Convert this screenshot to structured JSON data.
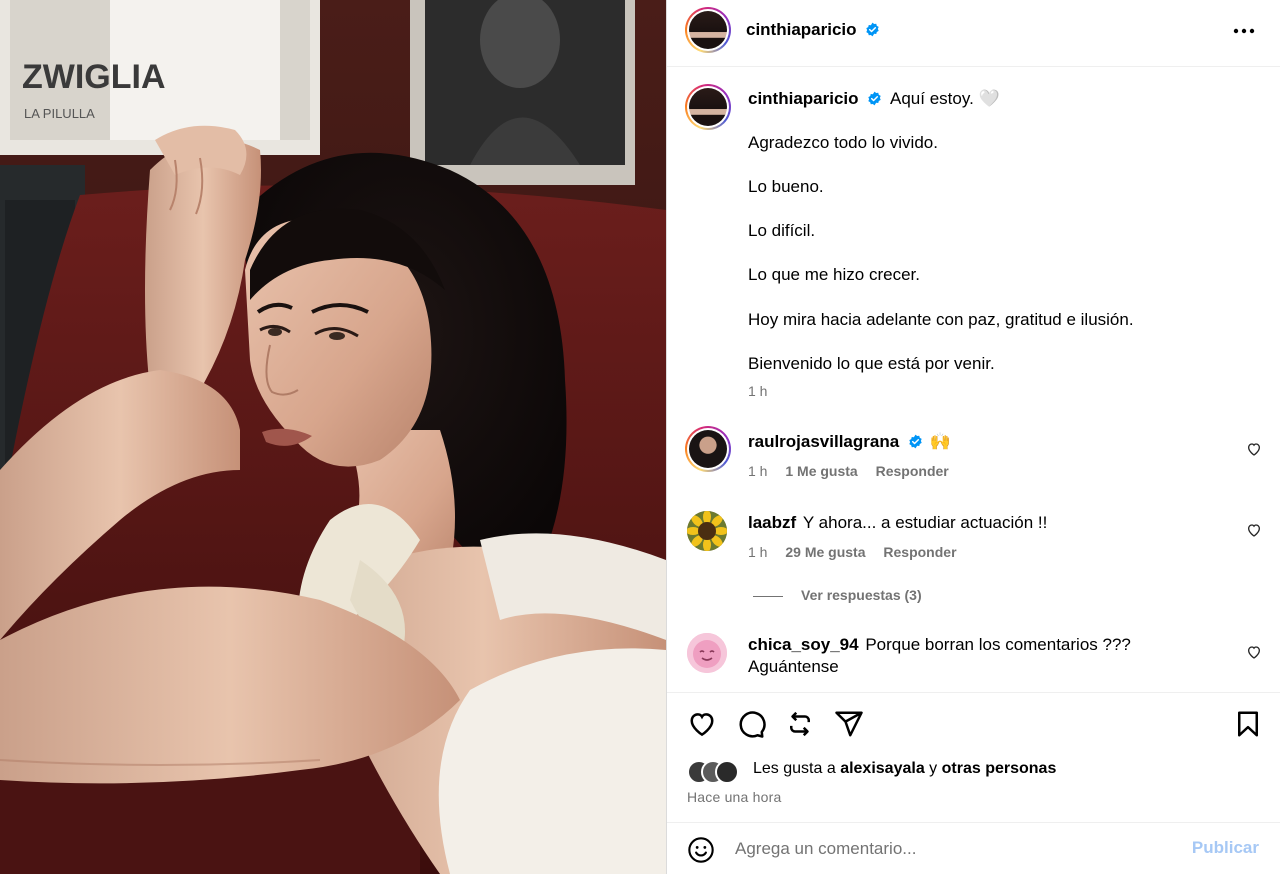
{
  "post": {
    "author": "cinthiaparicio",
    "author_verified": true,
    "more_icon": "more-horizontal-icon",
    "photo_wall_text_1": "ZWIGLIA",
    "photo_wall_text_2": "LA PILULLA"
  },
  "caption": {
    "author": "cinthiaparicio",
    "first_line": "Aquí estoy. 🤍",
    "lines": [
      "Agradezco todo lo vivido.",
      "Lo bueno.",
      "Lo difícil.",
      "Lo que me hizo crecer.",
      "Hoy mira hacia adelante con paz, gratitud e ilusión.",
      "Bienvenido lo que está por venir."
    ],
    "time": "1 h"
  },
  "comments": [
    {
      "user": "raulrojasvillagrana",
      "verified": true,
      "text": "🙌",
      "time": "1 h",
      "likes": "1 Me gusta",
      "reply": "Responder"
    },
    {
      "user": "laabzf",
      "verified": false,
      "text": "Y ahora... a estudiar actuación !!",
      "time": "1 h",
      "likes": "29 Me gusta",
      "reply": "Responder",
      "view_replies": "Ver respuestas (3)"
    },
    {
      "user": "chica_soy_94",
      "verified": false,
      "text": "Porque borran los comentarios ???",
      "text_line2": "Aguántense"
    }
  ],
  "actions": {
    "like_icon": "heart-icon",
    "comment_icon": "comment-icon",
    "repost_icon": "repost-icon",
    "share_icon": "share-icon",
    "save_icon": "bookmark-icon"
  },
  "likes": {
    "prefix": "Les gusta a",
    "user": "alexisayala",
    "joiner": "y",
    "others": "otras personas"
  },
  "posted": "Hace una hora",
  "comment_box": {
    "placeholder": "Agrega un comentario...",
    "publish_label": "Publicar",
    "emoji_icon": "emoji-icon"
  },
  "colors": {
    "accent_blue": "#0095f6",
    "verified_blue": "#0095f6",
    "muted_text": "#737373",
    "publish_disabled": "#a6c8f5"
  }
}
